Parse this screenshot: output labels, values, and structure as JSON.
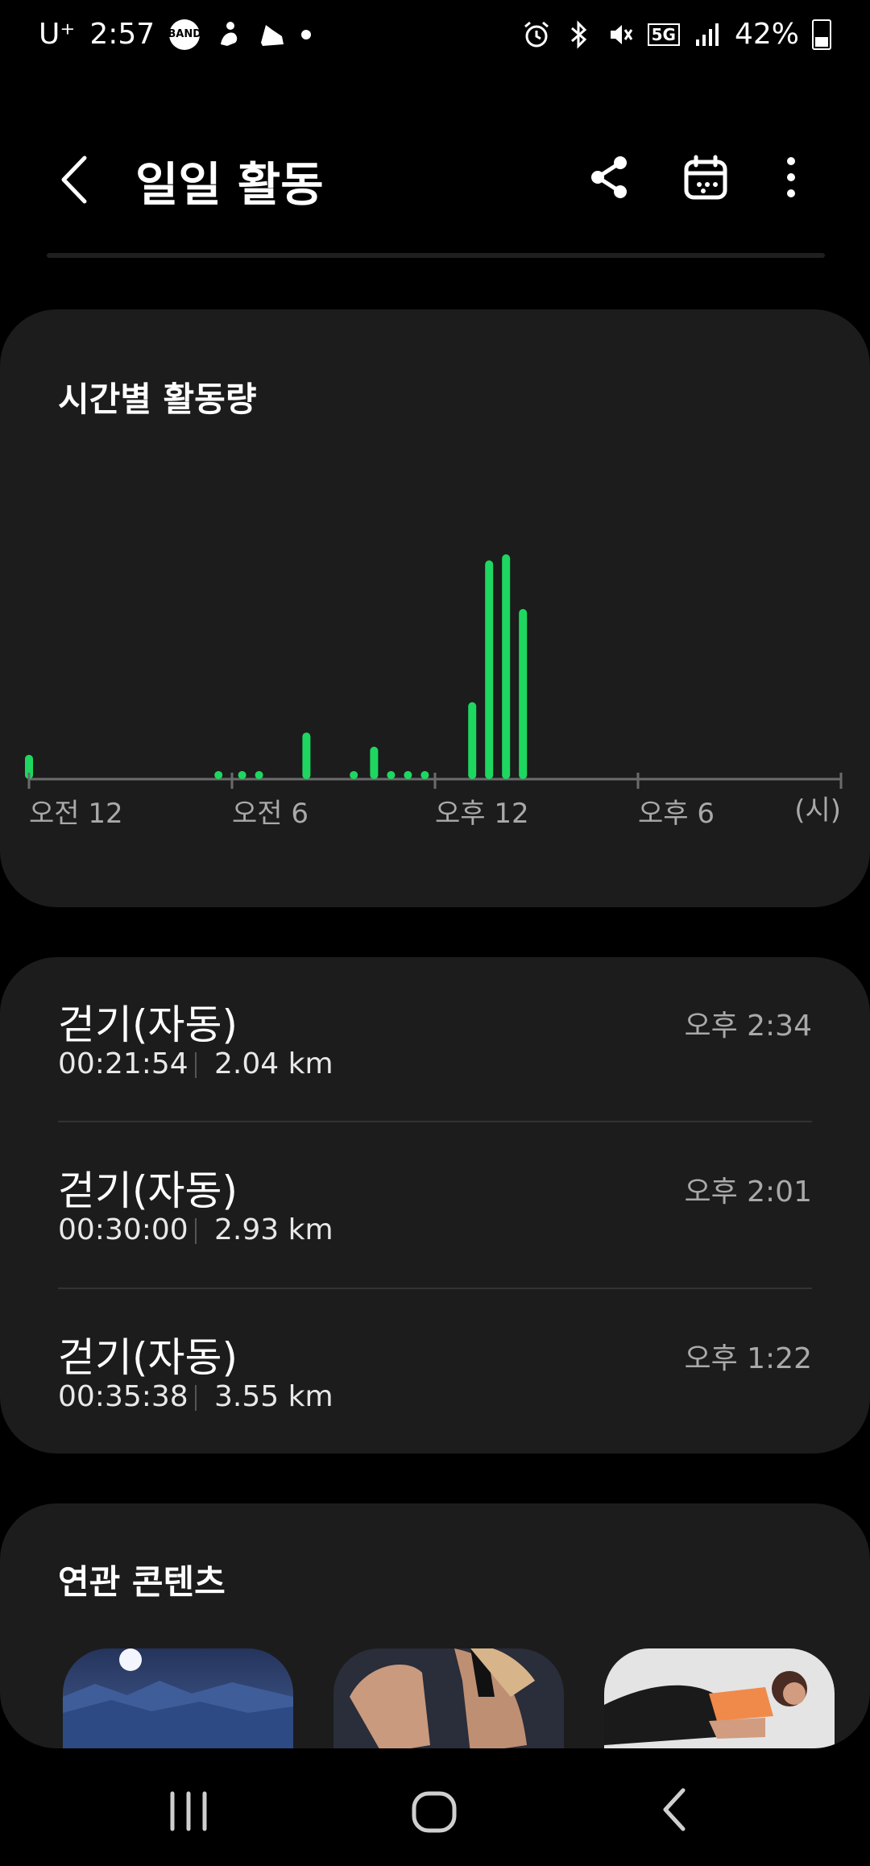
{
  "status_bar": {
    "carrier": "U⁺",
    "time": "2:57",
    "band_label": "BAND",
    "battery_percent": "42%",
    "network": "5G"
  },
  "app_bar": {
    "title": "일일 활동",
    "icons": [
      "back-icon",
      "share-icon",
      "calendar-icon",
      "more-icon"
    ]
  },
  "hourly_card": {
    "title": "시간별 활동량"
  },
  "chart_data": {
    "type": "bar",
    "title": "시간별 활동량",
    "x_ticks": [
      "오전 12",
      "오전 6",
      "오후 12",
      "오후 6"
    ],
    "x_unit": "(시)",
    "bar_color": "#1ed760",
    "x": [
      0,
      5.6,
      6.3,
      6.8,
      8.2,
      9.6,
      10.2,
      10.7,
      11.2,
      11.7,
      13.1,
      13.6,
      14.1,
      14.6
    ],
    "values": [
      12,
      4,
      4,
      4,
      23,
      4,
      16,
      4,
      4,
      4,
      38,
      108,
      111,
      84
    ],
    "xlim": [
      0,
      24
    ]
  },
  "activities": [
    {
      "title": "걷기(자동)",
      "duration": "00:21:54",
      "distance": "2.04 km",
      "time": "오후 2:34"
    },
    {
      "title": "걷기(자동)",
      "duration": "00:30:00",
      "distance": "2.93 km",
      "time": "오후 2:01"
    },
    {
      "title": "걷기(자동)",
      "duration": "00:35:38",
      "distance": "3.55 km",
      "time": "오후 1:22"
    }
  ],
  "related_card": {
    "title": "연관 콘텐츠",
    "thumbnails": [
      "night-mountain-landscape-image",
      "woman-back-workout-image",
      "woman-plank-exercise-image"
    ]
  },
  "colors": {
    "background": "#000000",
    "card": "#1c1c1c",
    "accent_green": "#1ed760",
    "secondary_text": "#a9a9a9"
  }
}
